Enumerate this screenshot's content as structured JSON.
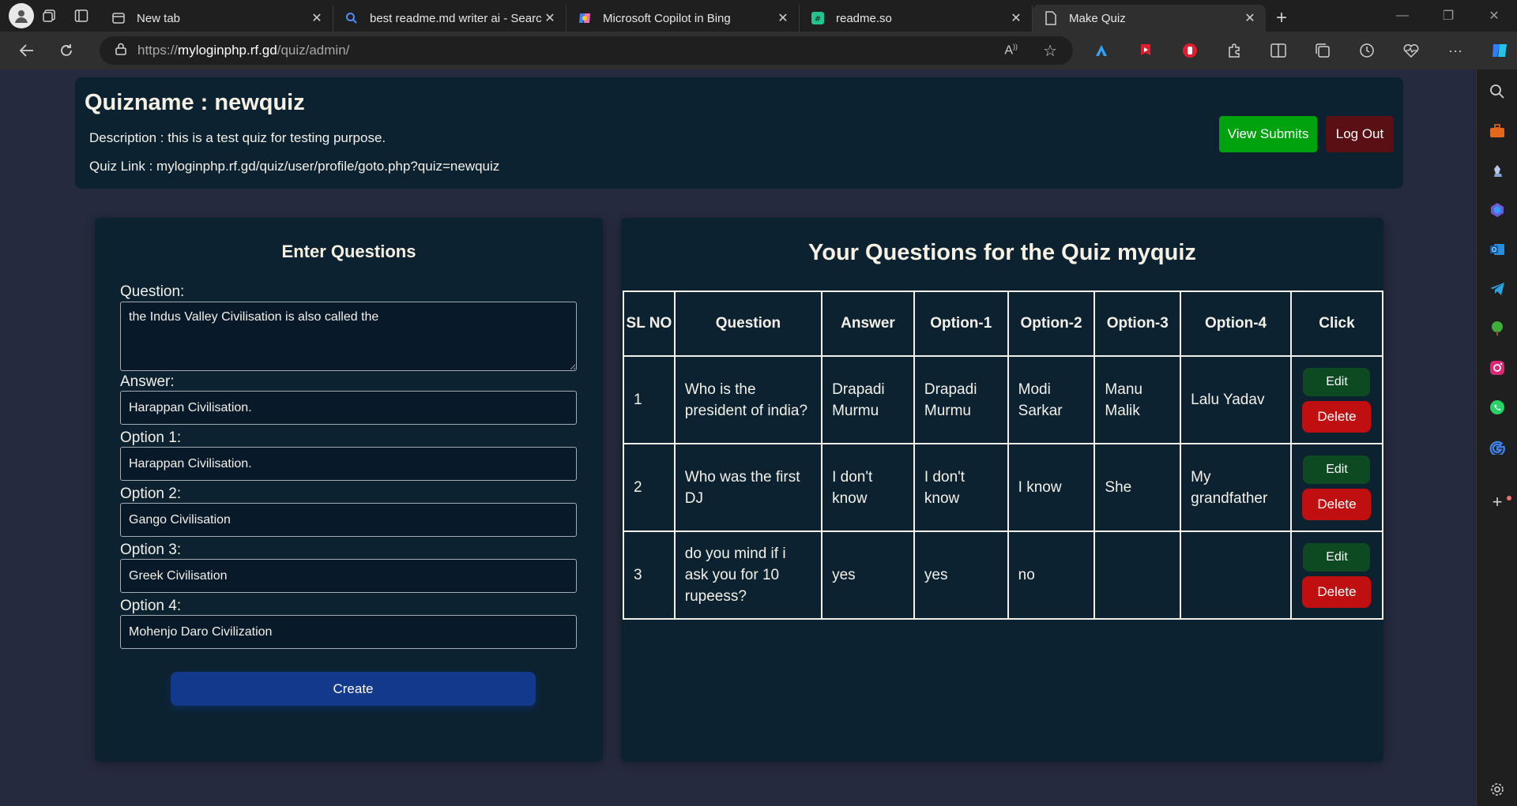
{
  "browser": {
    "tabs": [
      {
        "title": "New tab",
        "icon": "newtab-icon"
      },
      {
        "title": "best readme.md writer ai - Search",
        "icon": "search-icon"
      },
      {
        "title": "Microsoft Copilot in Bing",
        "icon": "copilot-icon"
      },
      {
        "title": "readme.so",
        "icon": "readme-icon"
      },
      {
        "title": "Make Quiz",
        "icon": "page-icon"
      }
    ],
    "url_prefix": "https://",
    "url_host": "myloginphp.rf.gd",
    "url_path": "/quiz/admin/",
    "colors": {
      "chrome": "#1f1f1f",
      "active_tab": "#2f2f2f"
    }
  },
  "header": {
    "quizname": "Quizname : newquiz",
    "description": "Description : this is a test quiz for testing purpose.",
    "quiz_link": "Quiz Link : myloginphp.rf.gd/quiz/user/profile/goto.php?quiz=newquiz",
    "view_submits_label": "View Submits",
    "logout_label": "Log Out"
  },
  "form": {
    "title": "Enter Questions",
    "question_label": "Question:",
    "question_value": "the Indus Valley Civilisation is also called the",
    "answer_label": "Answer:",
    "answer_value": "Harappan Civilisation.",
    "option1_label": "Option 1:",
    "option1_value": "Harappan Civilisation.",
    "option2_label": "Option 2:",
    "option2_value": "Gango Civilisation",
    "option3_label": "Option 3:",
    "option3_value": "Greek Civilisation",
    "option4_label": "Option 4:",
    "option4_value": "Mohenjo Daro Civilization",
    "create_label": "Create"
  },
  "questions": {
    "title": "Your Questions for the Quiz myquiz",
    "headers": [
      "SL NO",
      "Question",
      "Answer",
      "Option-1",
      "Option-2",
      "Option-3",
      "Option-4",
      "Click"
    ],
    "edit_label": "Edit",
    "delete_label": "Delete",
    "rows": [
      {
        "sl": "1",
        "question": "Who is the president of india?",
        "answer": "Drapadi Murmu",
        "opt1": "Drapadi Murmu",
        "opt2": "Modi Sarkar",
        "opt3": "Manu Malik",
        "opt4": "Lalu Yadav"
      },
      {
        "sl": "2",
        "question": "Who was the first DJ",
        "answer": "I don't know",
        "opt1": "I don't know",
        "opt2": "I know",
        "opt3": "She",
        "opt4": "My grandfather"
      },
      {
        "sl": "3",
        "question": "do you mind if i ask you for 10 rupeess?",
        "answer": "yes",
        "opt1": "yes",
        "opt2": "no",
        "opt3": "",
        "opt4": ""
      }
    ]
  },
  "colors": {
    "page_bg": "#262a3f",
    "card_bg": "#0c2230",
    "view_submits": "#00a30e",
    "logout": "#5a0f14",
    "create": "#12398c",
    "edit": "#0d4a22",
    "delete": "#c00f10"
  }
}
